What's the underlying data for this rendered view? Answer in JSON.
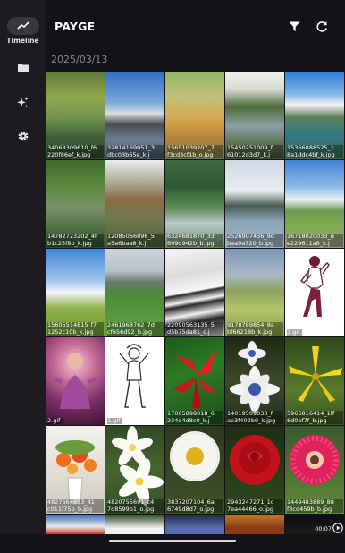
{
  "app": {
    "title": "PAYGE"
  },
  "rail": {
    "items": [
      {
        "label": "Timeline",
        "icon": "timeline-icon"
      },
      {
        "label": "",
        "icon": "folder-icon"
      },
      {
        "label": "",
        "icon": "sparkles-icon"
      },
      {
        "label": "",
        "icon": "gear-icon"
      }
    ]
  },
  "toolbar": {
    "filter_icon": "filter-icon",
    "refresh_icon": "refresh-icon"
  },
  "section": {
    "date": "2025/03/13"
  },
  "tiles": [
    {
      "caption": "34068309610_f6\n220f86ef_k.jpg"
    },
    {
      "caption": "32814169051_3\ndbc03b65e_k.j"
    },
    {
      "caption": "15651039207_7\nf3cd3cf1b_o.jpg"
    },
    {
      "caption": "15450251009_f\n61012d3d7_k.j"
    },
    {
      "caption": "15366888525_1\n8a1ddc4bf_k.jpg"
    },
    {
      "caption": "14782723202_4f\nb1c25f8b_k.jpg"
    },
    {
      "caption": "12085066896_5\na5a6baa8_k.j"
    },
    {
      "caption": "6324681870_33\n699d942b_b.jpg"
    },
    {
      "caption": "2526907436_9d\nbaa9a720_b.jpg"
    },
    {
      "caption": "16718020033_d\ne229611a8_k.j"
    },
    {
      "caption": "15605514815_f7\n1252c10b_k.jpg"
    },
    {
      "caption": "2461968762_7d\ncf656d92_b.jpg"
    },
    {
      "caption": "22090563135_5\nd5b75da81_c.j"
    },
    {
      "caption": "9178789854_9a\nbf66218b_k.jpg"
    },
    {
      "caption": "3.gif"
    },
    {
      "caption": "2.gif"
    },
    {
      "caption": "1.gif"
    },
    {
      "caption": "17065898018_6\n234d4d8c0_k.j"
    },
    {
      "caption": "14019509033_f\nae3f402b9_k.jpg"
    },
    {
      "caption": "5966816414_1ff\n6d0af7f_b.jpg"
    },
    {
      "caption": "4827664853_41\nc011f75b_b.jpg"
    },
    {
      "caption": "4820755691_c4\n7d8599b1_o.jpg"
    },
    {
      "caption": "3837207104_6a\n6749d8d7_o.jpg"
    },
    {
      "caption": "2943247271_1c\n7ea44466_o.jpg"
    },
    {
      "caption": "1449483889_88\nf3cd459b_b.jpg"
    }
  ],
  "partial_row": {
    "video_duration": "00:07"
  },
  "colors": {
    "background": "#141218",
    "rail_background": "#1d1b20",
    "active_pill": "#3a3640",
    "muted_text": "#8c8794"
  }
}
